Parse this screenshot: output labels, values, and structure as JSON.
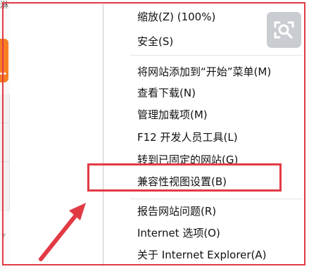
{
  "background_page": {
    "partial_text": "淋"
  },
  "menu": {
    "items": [
      {
        "label": "缩放(Z) (100%)"
      },
      {
        "label": "安全(S)"
      },
      {
        "label": "将网站添加到“开始”菜单(M)"
      },
      {
        "label": "查看下载(N)"
      },
      {
        "label": "管理加载项(M)"
      },
      {
        "label": "F12 开发人员工具(L)"
      },
      {
        "label": "转到已固定的网站(G)"
      },
      {
        "label": "兼容性视图设置(B)"
      },
      {
        "label": "报告网站问题(R)"
      },
      {
        "label": "Internet 选项(O)"
      },
      {
        "label": "关于 Internet Explorer(A)"
      }
    ],
    "highlighted_item": "兼容性视图设置(B)"
  },
  "colors": {
    "annotation_red": "#e23a45",
    "accent_orange": "#f77f22",
    "icon_button_grey": "#c9ccd1"
  },
  "icons": {
    "search_button": "search-icon"
  }
}
